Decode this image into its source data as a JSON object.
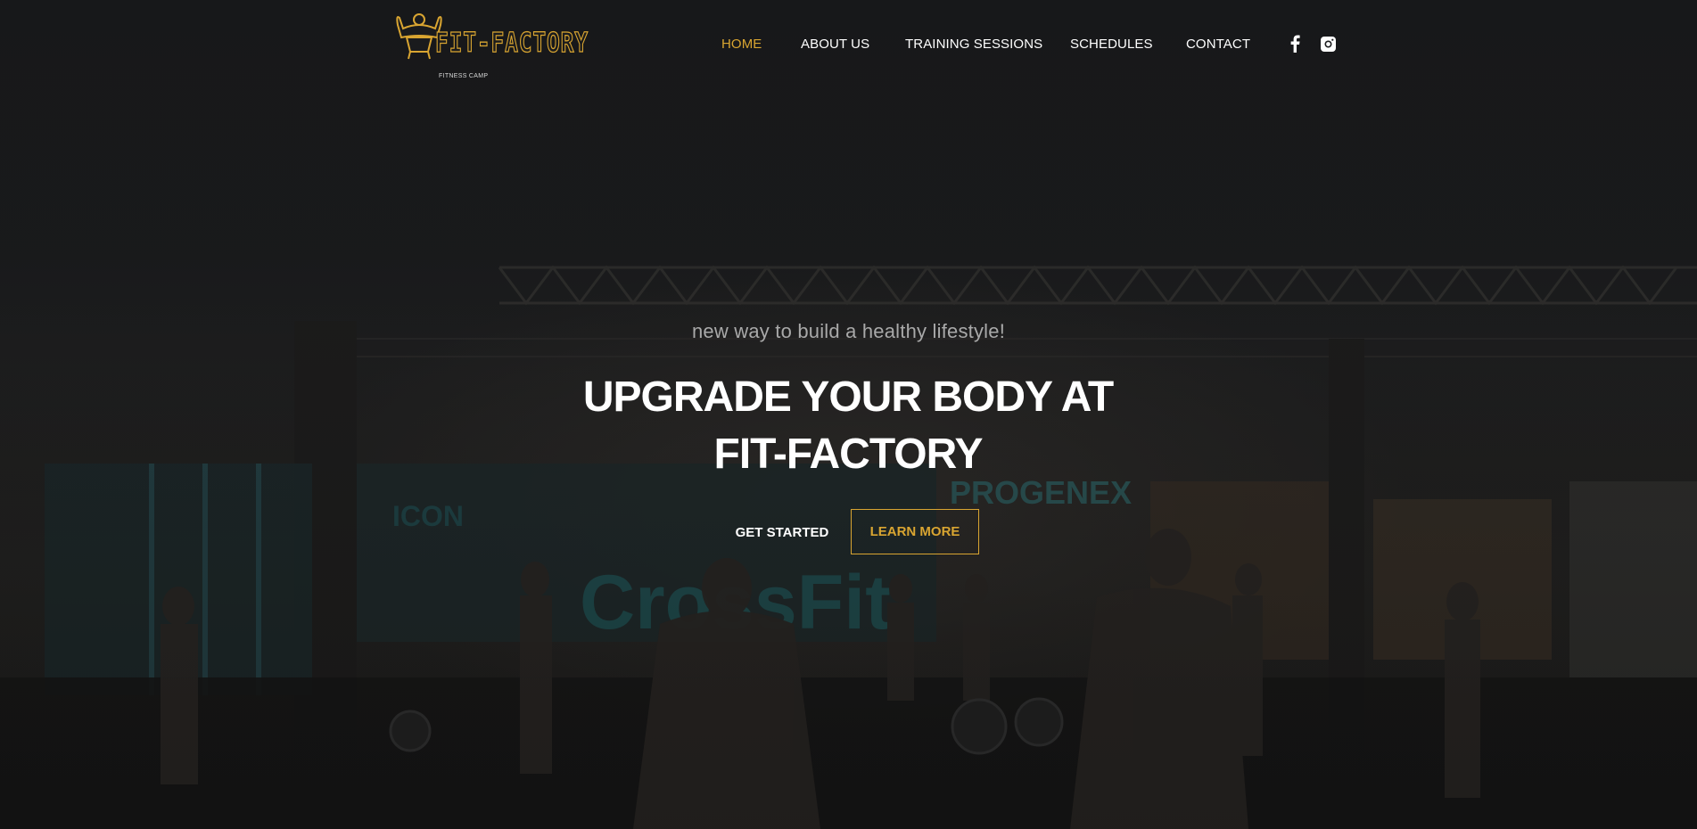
{
  "brand": {
    "name": "FIT-FACTORY",
    "tagline": "FITNESS CAMP",
    "accent_color": "#d9a531"
  },
  "nav": {
    "items": [
      {
        "label": "HOME",
        "active": true
      },
      {
        "label": "ABOUT US",
        "active": false
      },
      {
        "label": "TRAINING SESSIONS",
        "active": false
      },
      {
        "label": "SCHEDULES",
        "active": false
      },
      {
        "label": "CONTACT",
        "active": false
      }
    ]
  },
  "social": {
    "icons": [
      "facebook-icon",
      "instagram-icon"
    ]
  },
  "hero": {
    "subtitle": "new way to build a healthy lifestyle!",
    "title_line1": "UPGRADE YOUR BODY AT",
    "title_line2": "FIT-FACTORY",
    "primary_button": "GET STARTED",
    "secondary_button": "LEARN MORE",
    "background": "gym-photo-background"
  }
}
